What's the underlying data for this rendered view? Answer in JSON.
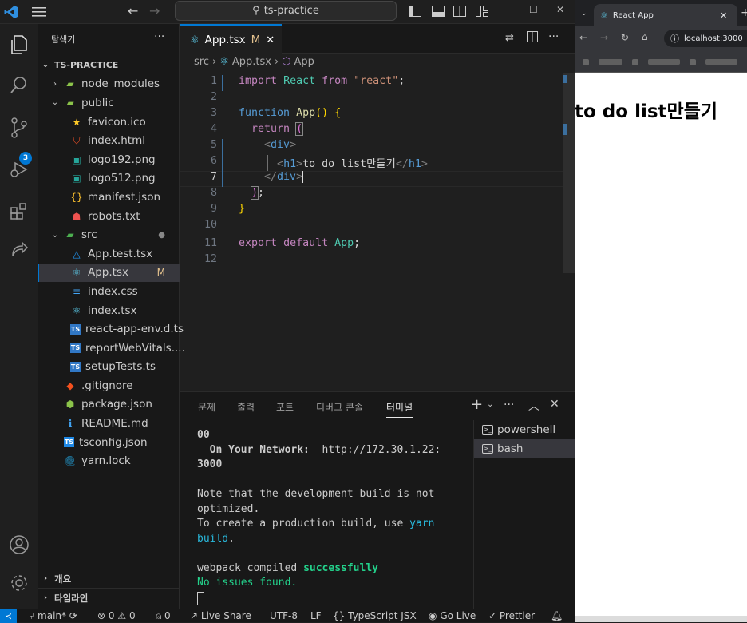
{
  "window": {
    "search_text": "ts-practice"
  },
  "activity": {
    "scm_badge": "3"
  },
  "sidebar": {
    "title": "탐색기",
    "more": "···",
    "root": "TS-PRACTICE",
    "items": [
      {
        "label": "node_modules",
        "kind": "folder",
        "depth": 1,
        "open": false
      },
      {
        "label": "public",
        "kind": "folder",
        "depth": 1,
        "open": true
      },
      {
        "label": "favicon.ico",
        "kind": "star",
        "depth": 2
      },
      {
        "label": "index.html",
        "kind": "html",
        "depth": 2
      },
      {
        "label": "logo192.png",
        "kind": "image",
        "depth": 2
      },
      {
        "label": "logo512.png",
        "kind": "image",
        "depth": 2
      },
      {
        "label": "manifest.json",
        "kind": "json",
        "depth": 2
      },
      {
        "label": "robots.txt",
        "kind": "robot",
        "depth": 2
      },
      {
        "label": "src",
        "kind": "srcfolder",
        "depth": 1,
        "open": true,
        "dot": "●"
      },
      {
        "label": "App.test.tsx",
        "kind": "test",
        "depth": 2
      },
      {
        "label": "App.tsx",
        "kind": "react",
        "depth": 2,
        "selected": true,
        "mod": "M"
      },
      {
        "label": "index.css",
        "kind": "css",
        "depth": 2
      },
      {
        "label": "index.tsx",
        "kind": "react",
        "depth": 2
      },
      {
        "label": "react-app-env.d.ts",
        "kind": "ts",
        "depth": 2
      },
      {
        "label": "reportWebVitals....",
        "kind": "ts",
        "depth": 2
      },
      {
        "label": "setupTests.ts",
        "kind": "ts",
        "depth": 2
      },
      {
        "label": ".gitignore",
        "kind": "git",
        "depth": 1
      },
      {
        "label": "package.json",
        "kind": "npm",
        "depth": 1
      },
      {
        "label": "README.md",
        "kind": "info",
        "depth": 1
      },
      {
        "label": "tsconfig.json",
        "kind": "tsconfig",
        "depth": 1
      },
      {
        "label": "yarn.lock",
        "kind": "yarn",
        "depth": 1
      }
    ],
    "outline": "개요",
    "timeline": "타임라인"
  },
  "editor": {
    "tab_label": "App.tsx",
    "tab_mod": "M",
    "breadcrumb": [
      "src",
      "App.tsx",
      "App"
    ],
    "line_numbers": [
      "1",
      "2",
      "3",
      "4",
      "5",
      "6",
      "7",
      "8",
      "9",
      "10",
      "11",
      "12"
    ],
    "current_line": "7"
  },
  "panel": {
    "tabs": [
      "문제",
      "출력",
      "포트",
      "디버그 콘솔",
      "터미널"
    ],
    "terminals": [
      "powershell",
      "bash"
    ],
    "output": {
      "l1": "00",
      "l2_a": "  On Your Network:",
      "l2_b": "  http://172.30.1.22:",
      "l3": "3000",
      "l4": "Note that the development build is not",
      "l5": "optimized.",
      "l6_a": "To create a production build, use ",
      "l6_b": "yarn",
      "l7": "build",
      "l7_b": ".",
      "l8_a": "webpack compiled ",
      "l8_b": "successfully",
      "l9": "No issues found."
    }
  },
  "status": {
    "branch": "main*",
    "errors": "0",
    "warnings": "0",
    "ports": "0",
    "live_share": "Live Share",
    "encoding": "UTF-8",
    "eol": "LF",
    "language": "TypeScript JSX",
    "go_live": "Go Live",
    "prettier": "Prettier"
  },
  "browser": {
    "tab_title": "React App",
    "url": "localhost:3000",
    "heading": "to do list만들기"
  },
  "colors": {
    "accent": "#0078d4",
    "modified": "#e2c08d",
    "terminal_green": "#23d18b"
  }
}
